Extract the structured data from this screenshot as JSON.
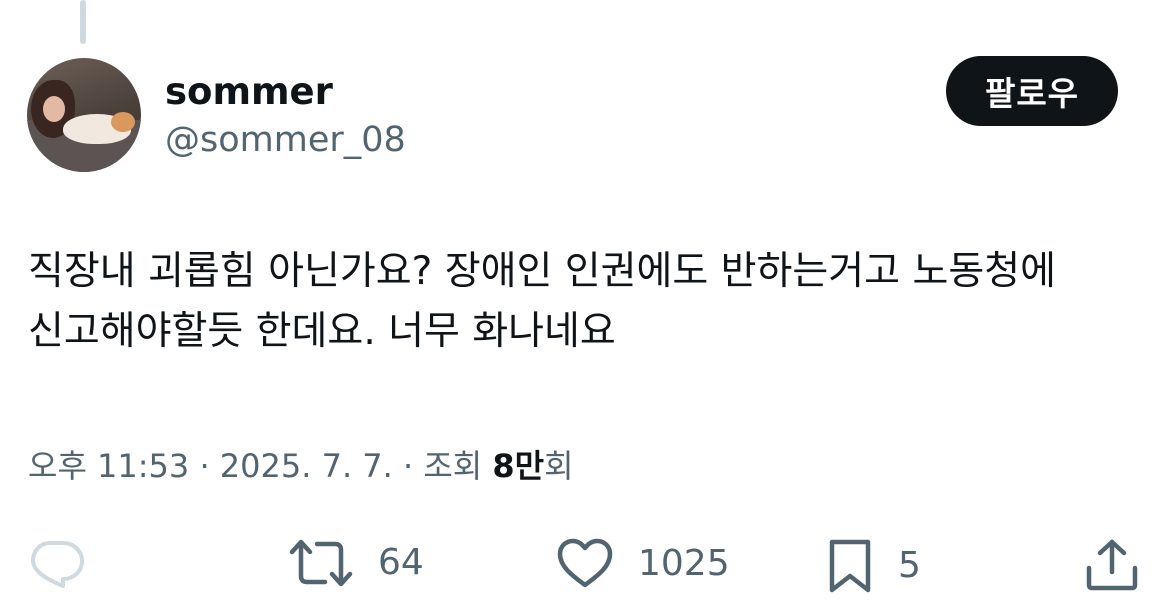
{
  "author": {
    "display_name": "sommer",
    "handle": "@sommer_08",
    "follow_label": "팔로우"
  },
  "post": {
    "text": "직장내 괴롭힘 아닌가요? 장애인 인권에도 반하는거고 노동청에\n신고해야할듯 한데요. 너무 화나네요"
  },
  "meta": {
    "time": "오후 11:53",
    "separator": " · ",
    "date": "2025. 7. 7.",
    "views_prefix": "조회 ",
    "views_count": "8만",
    "views_suffix": "회"
  },
  "actions": {
    "reply_icon": "reply-icon",
    "retweet_icon": "retweet-icon",
    "retweets": "64",
    "like_icon": "heart-icon",
    "likes": "1025",
    "bookmark_icon": "bookmark-icon",
    "bookmarks": "5",
    "share_icon": "share-icon"
  },
  "colors": {
    "text_primary": "#0f1419",
    "text_secondary": "#536471",
    "reply_icon_disabled": "#cfd9de",
    "follow_bg": "#0f1419"
  }
}
